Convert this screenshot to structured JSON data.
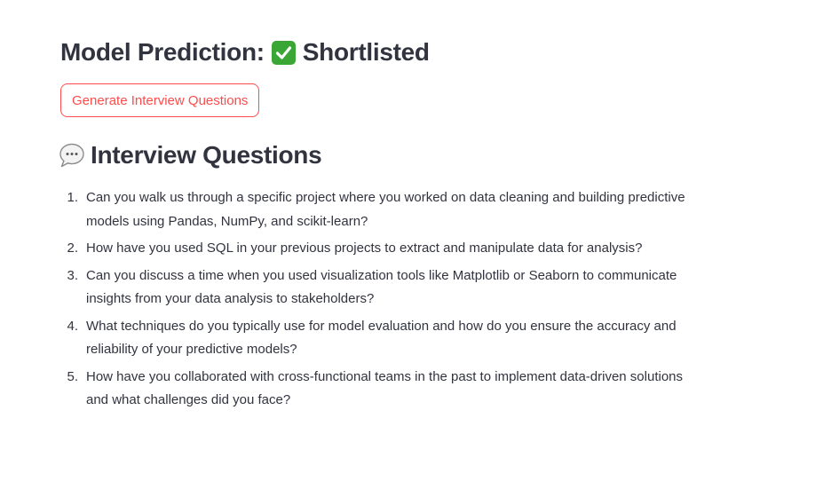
{
  "prediction": {
    "label": "Model Prediction:",
    "status": "Shortlisted",
    "status_icon": "check-mark-button-icon"
  },
  "generate_button": {
    "label": "Generate Interview Questions"
  },
  "questions_section": {
    "title": "Interview Questions",
    "title_icon": "speech-bubble-icon",
    "items": [
      {
        "number": "1.",
        "text": "Can you walk us through a specific project where you worked on data cleaning and building predictive models using Pandas, NumPy, and scikit-learn?"
      },
      {
        "number": "2.",
        "text": "How have you used SQL in your previous projects to extract and manipulate data for analysis?"
      },
      {
        "number": "3.",
        "text": "Can you discuss a time when you used visualization tools like Matplotlib or Seaborn to communicate insights from your data analysis to stakeholders?"
      },
      {
        "number": "4.",
        "text": "What techniques do you typically use for model evaluation and how do you ensure the accuracy and reliability of your predictive models?"
      },
      {
        "number": "5.",
        "text": "How have you collaborated with cross-functional teams in the past to implement data-driven solutions and what challenges did you face?"
      }
    ]
  },
  "colors": {
    "text": "#31333f",
    "accent": "#ff4b4b",
    "check_green": "#3aa635"
  }
}
